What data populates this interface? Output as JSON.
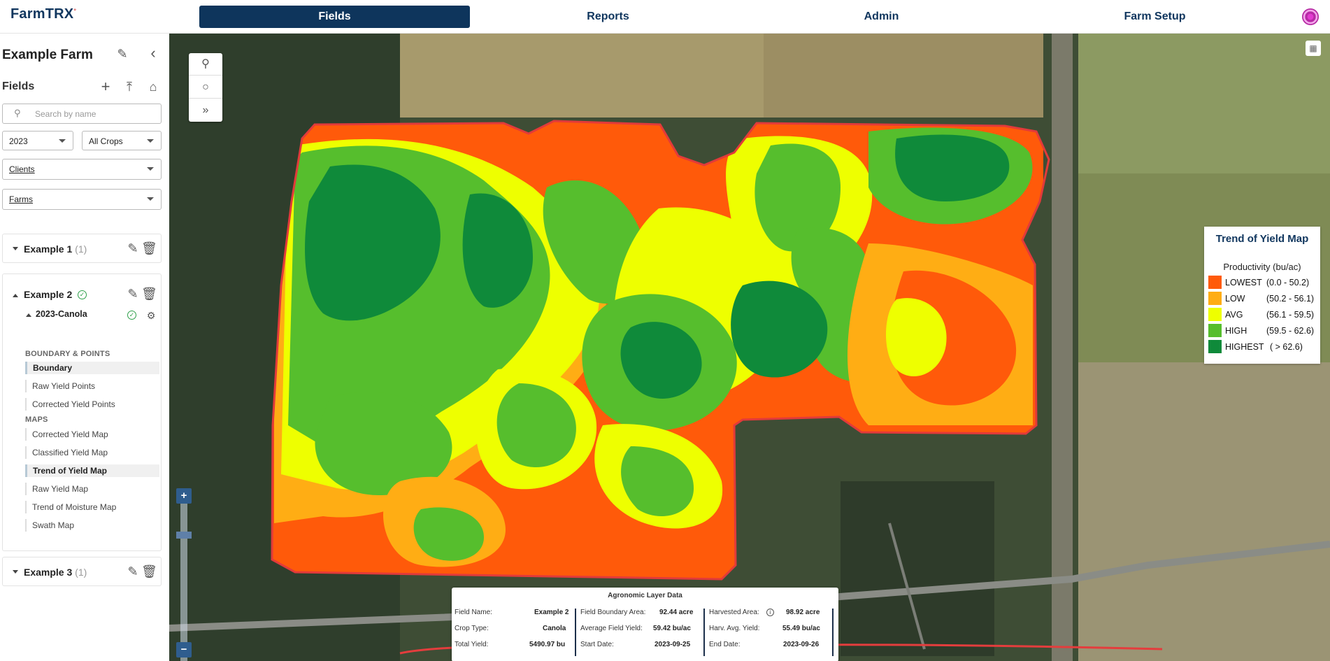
{
  "header": {
    "logo": "FarmTRX",
    "nav": [
      "Fields",
      "Reports",
      "Admin",
      "Farm Setup"
    ],
    "active_nav": "Fields",
    "user_avatar_icon": "user-avatar-icon"
  },
  "sidebar": {
    "farm_title": "Example Farm",
    "fields_title": "Fields",
    "search_placeholder": "Search by name",
    "year": "2023",
    "crop": "All Crops",
    "clients": "Clients",
    "farms": "Farms",
    "fields": [
      {
        "name": "Example 1",
        "count": "(1)"
      },
      {
        "name": "Example 2",
        "crop": "2023-Canola",
        "sections": {
          "boundary_label": "BOUNDARY & POINTS",
          "boundary_items": [
            "Boundary",
            "Raw Yield Points",
            "Corrected Yield Points"
          ],
          "maps_label": "MAPS",
          "map_items": [
            "Corrected Yield Map",
            "Classified Yield Map",
            "Trend of Yield Map",
            "Raw Yield Map",
            "Trend of Moisture Map",
            "Swath Map"
          ]
        }
      },
      {
        "name": "Example 3",
        "count": "(1)"
      }
    ],
    "selected_boundary_item": "Boundary",
    "selected_map_item": "Trend of Yield Map"
  },
  "map": {
    "zoom_in": "+",
    "zoom_out": "−"
  },
  "legend": {
    "title": "Trend of Yield Map",
    "subtitle": "Productivity (bu/ac)",
    "rows": [
      {
        "name": "LOWEST",
        "range": "(0.0 - 50.2)",
        "color": "#ff5a0a"
      },
      {
        "name": "LOW",
        "range": "(50.2 - 56.1)",
        "color": "#ffad14"
      },
      {
        "name": "AVG",
        "range": "(56.1 - 59.5)",
        "color": "#eeff00"
      },
      {
        "name": "HIGH",
        "range": "(59.5 - 62.6)",
        "color": "#56be2d"
      },
      {
        "name": "HIGHEST",
        "range": "( > 62.6)",
        "color": "#0f8a3a"
      }
    ]
  },
  "info": {
    "title": "Agronomic Layer Data",
    "col1": [
      {
        "k": "Field Name:",
        "v": "Example 2"
      },
      {
        "k": "Crop Type:",
        "v": "Canola"
      },
      {
        "k": "Total Yield:",
        "v": "5490.97 bu"
      }
    ],
    "col2": [
      {
        "k": "Field Boundary Area:",
        "v": "92.44 acre"
      },
      {
        "k": "Average Field Yield:",
        "v": "59.42 bu/ac"
      },
      {
        "k": "Start Date:",
        "v": "2023-09-25"
      }
    ],
    "col3": [
      {
        "k": "Harvested Area:",
        "v": "98.92 acre"
      },
      {
        "k": "Harv. Avg. Yield:",
        "v": "55.49 bu/ac"
      },
      {
        "k": "End Date:",
        "v": "2023-09-26"
      }
    ]
  }
}
